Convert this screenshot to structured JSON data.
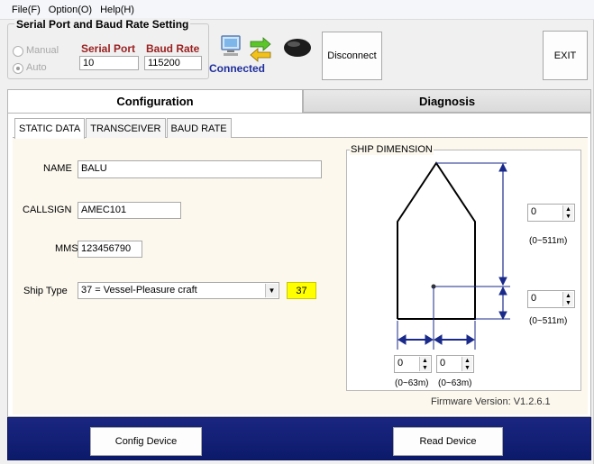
{
  "menu": {
    "file": "File(F)",
    "option": "Option(O)",
    "help": "Help(H)"
  },
  "serial": {
    "group_title": "Serial Port and Baud Rate Setting",
    "manual_label": "Manual",
    "auto_label": "Auto",
    "serial_port_label": "Serial Port",
    "baud_rate_label": "Baud Rate",
    "serial_port_value": "10",
    "baud_rate_value": "115200",
    "status": "Connected"
  },
  "buttons": {
    "disconnect": "Disconnect",
    "exit": "EXIT",
    "config_device": "Config Device",
    "read_device": "Read Device"
  },
  "main_tabs": {
    "configuration": "Configuration",
    "diagnosis": "Diagnosis"
  },
  "sub_tabs": {
    "static_data": "STATIC DATA",
    "transceiver": "TRANSCEIVER",
    "baud_rate": "BAUD RATE"
  },
  "static": {
    "name_label": "NAME",
    "name_value": "BALU",
    "callsign_label": "CALLSIGN",
    "callsign_value": "AMEC101",
    "mmsi_label": "MMSI",
    "mmsi_value": "123456790",
    "shiptype_label": "Ship Type",
    "shiptype_value": "37 = Vessel-Pleasure craft",
    "shiptype_code": "37"
  },
  "ship_dimension": {
    "title": "SHIP DIMENSION",
    "a_value": "0",
    "b_value": "0",
    "c_value": "0",
    "d_value": "0",
    "ab_range": "(0~511m)",
    "cd_range": "(0~63m)"
  },
  "firmware": "Firmware Version: V1.2.6.1",
  "colors": {
    "accent_blue": "#1f2f9c",
    "label_red": "#9a1f1f",
    "bottom_bar": "#14217a",
    "ship_type_badge": "#ffff00"
  }
}
